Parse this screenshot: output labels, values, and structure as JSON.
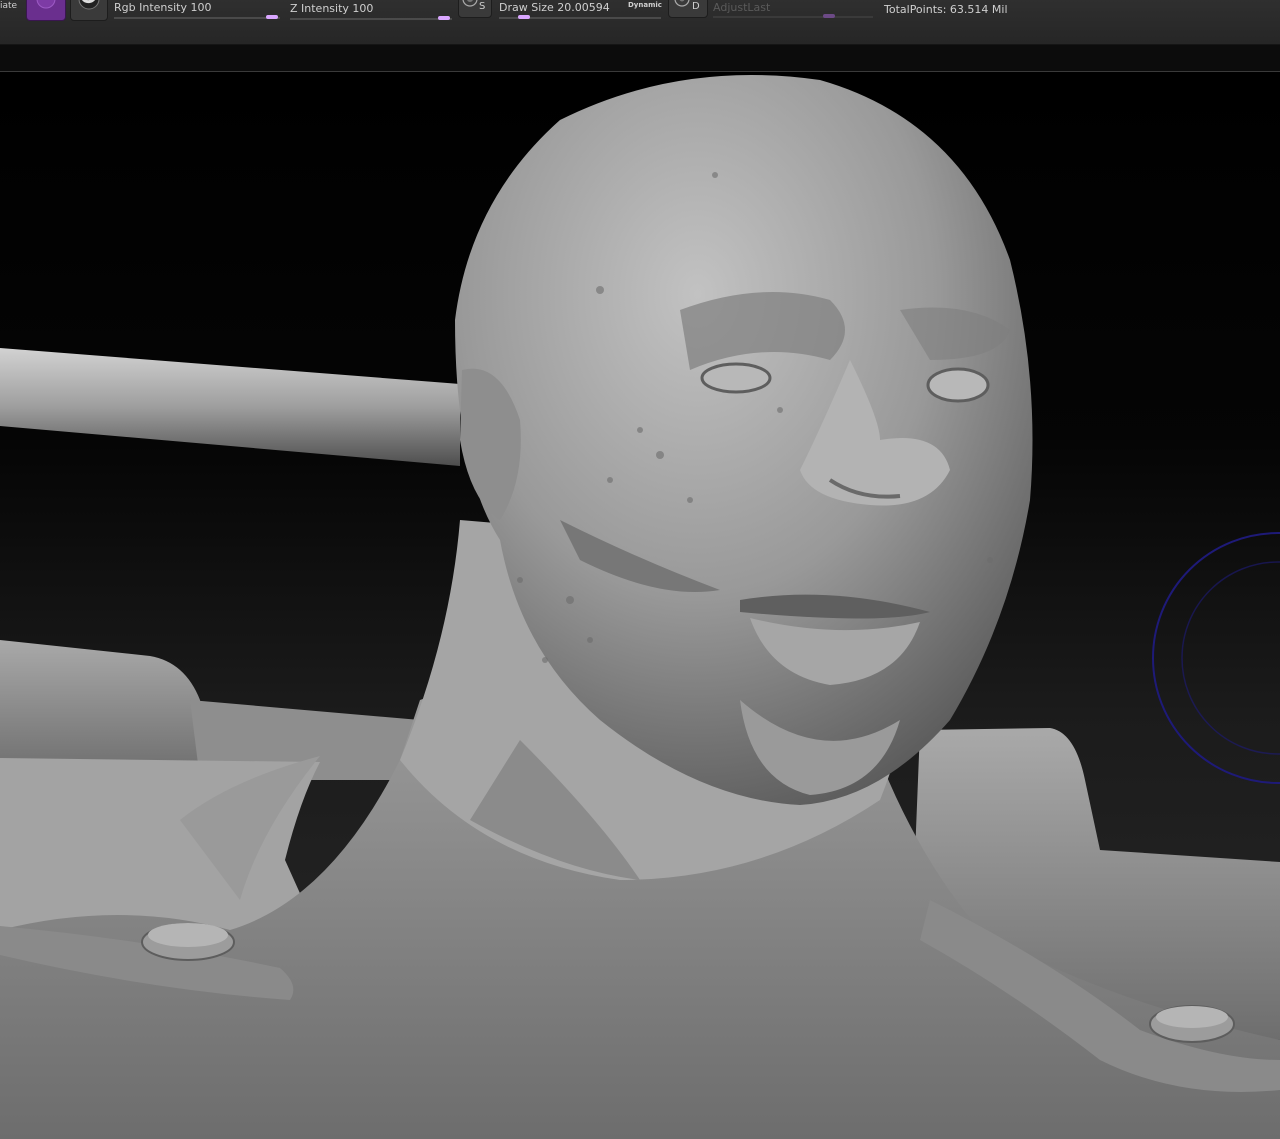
{
  "toolbar": {
    "edge_label": "iate",
    "rgb_intensity_label": "Rgb Intensity 100",
    "rgb_intensity_value": 100,
    "z_intensity_label": "Z Intensity 100",
    "z_intensity_value": 100,
    "sym_key": "S",
    "draw_size_label": "Draw Size 20.00594",
    "dynamic_label": "Dynamic",
    "dyn_key": "D",
    "adjust_last_label": "AdjustLast",
    "total_points_label": "TotalPoints: 63.514 Mil"
  },
  "colors": {
    "material_swatch": "#6a2f8e",
    "slider_handle": "#d9a6ff",
    "cursor_ring": "#1e1a78",
    "model_gray": "#8a8a8a"
  },
  "icons": {
    "material_swatch": "material-swatch-icon",
    "sphere_brush": "sphere-brush-icon",
    "symmetry": "symmetry-icon",
    "dynamics": "dynamics-icon",
    "brush_cursor": "brush-cursor-icon"
  }
}
